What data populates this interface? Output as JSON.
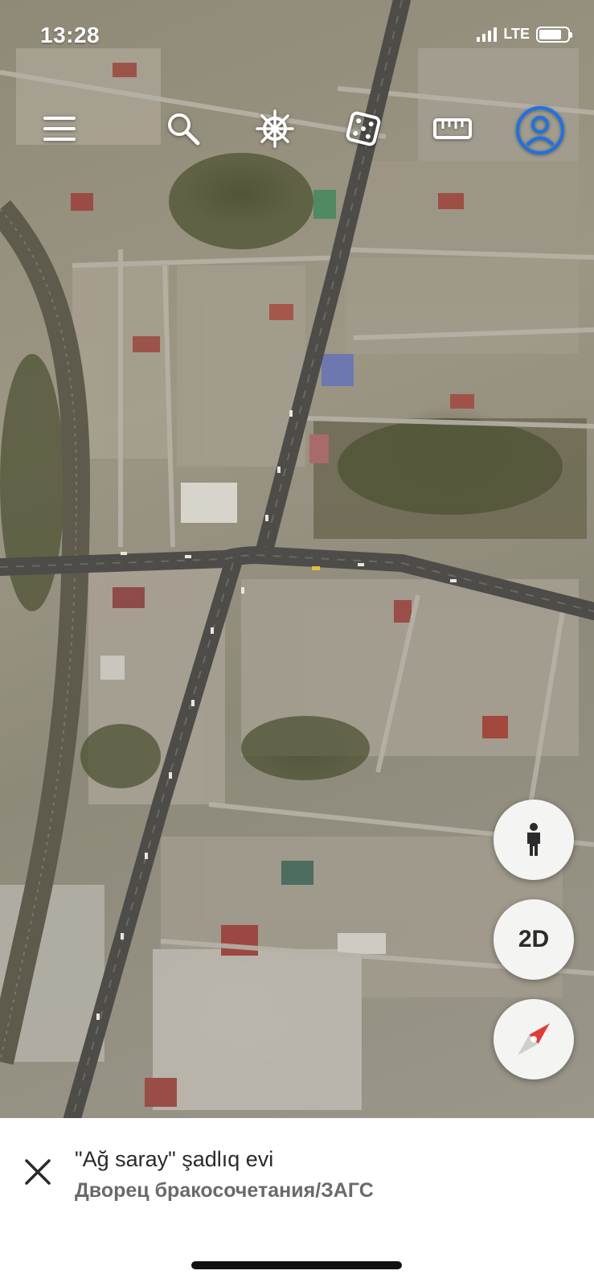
{
  "status_bar": {
    "time": "13:28",
    "network": "LTE",
    "battery_level": 0.8
  },
  "toolbar": {
    "items": [
      {
        "name": "menu",
        "icon": "menu-icon"
      },
      {
        "name": "search",
        "icon": "search-icon"
      },
      {
        "name": "voyager",
        "icon": "ship-wheel-icon"
      },
      {
        "name": "feeling-lucky",
        "icon": "dice-icon"
      },
      {
        "name": "measure",
        "icon": "ruler-icon"
      },
      {
        "name": "account",
        "icon": "account-icon"
      }
    ],
    "accent_color": "#1a73e8"
  },
  "map_controls": {
    "street_view_icon": "pegman-icon",
    "view_mode_label": "2D",
    "compass_icon": "compass-icon",
    "compass_color": "#e53935"
  },
  "place_card": {
    "title": "\"Ağ saray\" şadlıq evi",
    "subtitle": "Дворец бракосочетания/ЗАГС",
    "close_icon": "close-icon"
  }
}
